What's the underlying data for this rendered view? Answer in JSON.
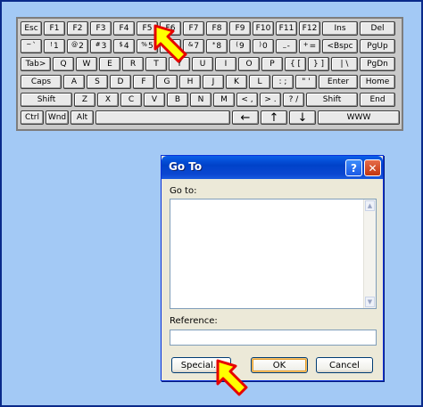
{
  "keyboard": {
    "row1": [
      "Esc",
      "F1",
      "F2",
      "F3",
      "F4",
      "F5",
      "F6",
      "F7",
      "F8",
      "F9",
      "F10",
      "F11",
      "F12",
      "Ins",
      "Del"
    ],
    "row2": [
      {
        "sub": "~",
        "main": "`"
      },
      {
        "sub": "!",
        "main": "1"
      },
      {
        "sub": "@",
        "main": "2"
      },
      {
        "sub": "#",
        "main": "3"
      },
      {
        "sub": "$",
        "main": "4"
      },
      {
        "sub": "%",
        "main": "5"
      },
      {
        "sub": "^",
        "main": "6"
      },
      {
        "sub": "&",
        "main": "7"
      },
      {
        "sub": "*",
        "main": "8"
      },
      {
        "sub": "(",
        "main": "9"
      },
      {
        "sub": ")",
        "main": "0"
      },
      {
        "sub": "_",
        "main": "-"
      },
      {
        "sub": "+",
        "main": "="
      },
      {
        "sub": "",
        "main": "<Bspc"
      },
      {
        "sub": "",
        "main": "PgUp"
      }
    ],
    "row3": [
      "Tab>",
      "Q",
      "W",
      "E",
      "R",
      "T",
      "Y",
      "U",
      "I",
      "O",
      "P",
      "{ [",
      "} ]",
      "| \\",
      "PgDn"
    ],
    "row4": [
      "Caps",
      "A",
      "S",
      "D",
      "F",
      "G",
      "H",
      "J",
      "K",
      "L",
      ": ;",
      "\" '",
      "Enter",
      "Home"
    ],
    "row5": [
      "Shift",
      "Z",
      "X",
      "C",
      "V",
      "B",
      "N",
      "M",
      "< ,",
      "> .",
      "? /",
      "Shift",
      "End"
    ],
    "row6": [
      "Ctrl",
      "Wnd",
      "Alt",
      "←",
      "↑",
      "↓",
      "WWW"
    ]
  },
  "dialog": {
    "title": "Go To",
    "help_label": "?",
    "close_label": "✕",
    "goto_label": "Go to:",
    "reference_label": "Reference:",
    "reference_value": "",
    "special_label": "Special...",
    "ok_label": "OK",
    "cancel_label": "Cancel"
  },
  "icons": {
    "pointer": "yellow-arrow-pointer-icon"
  },
  "colors": {
    "background": "#a3c9f5",
    "titlebar": "#0042c9",
    "pointer_fill": "#ffff00",
    "pointer_outline": "#e60000"
  }
}
